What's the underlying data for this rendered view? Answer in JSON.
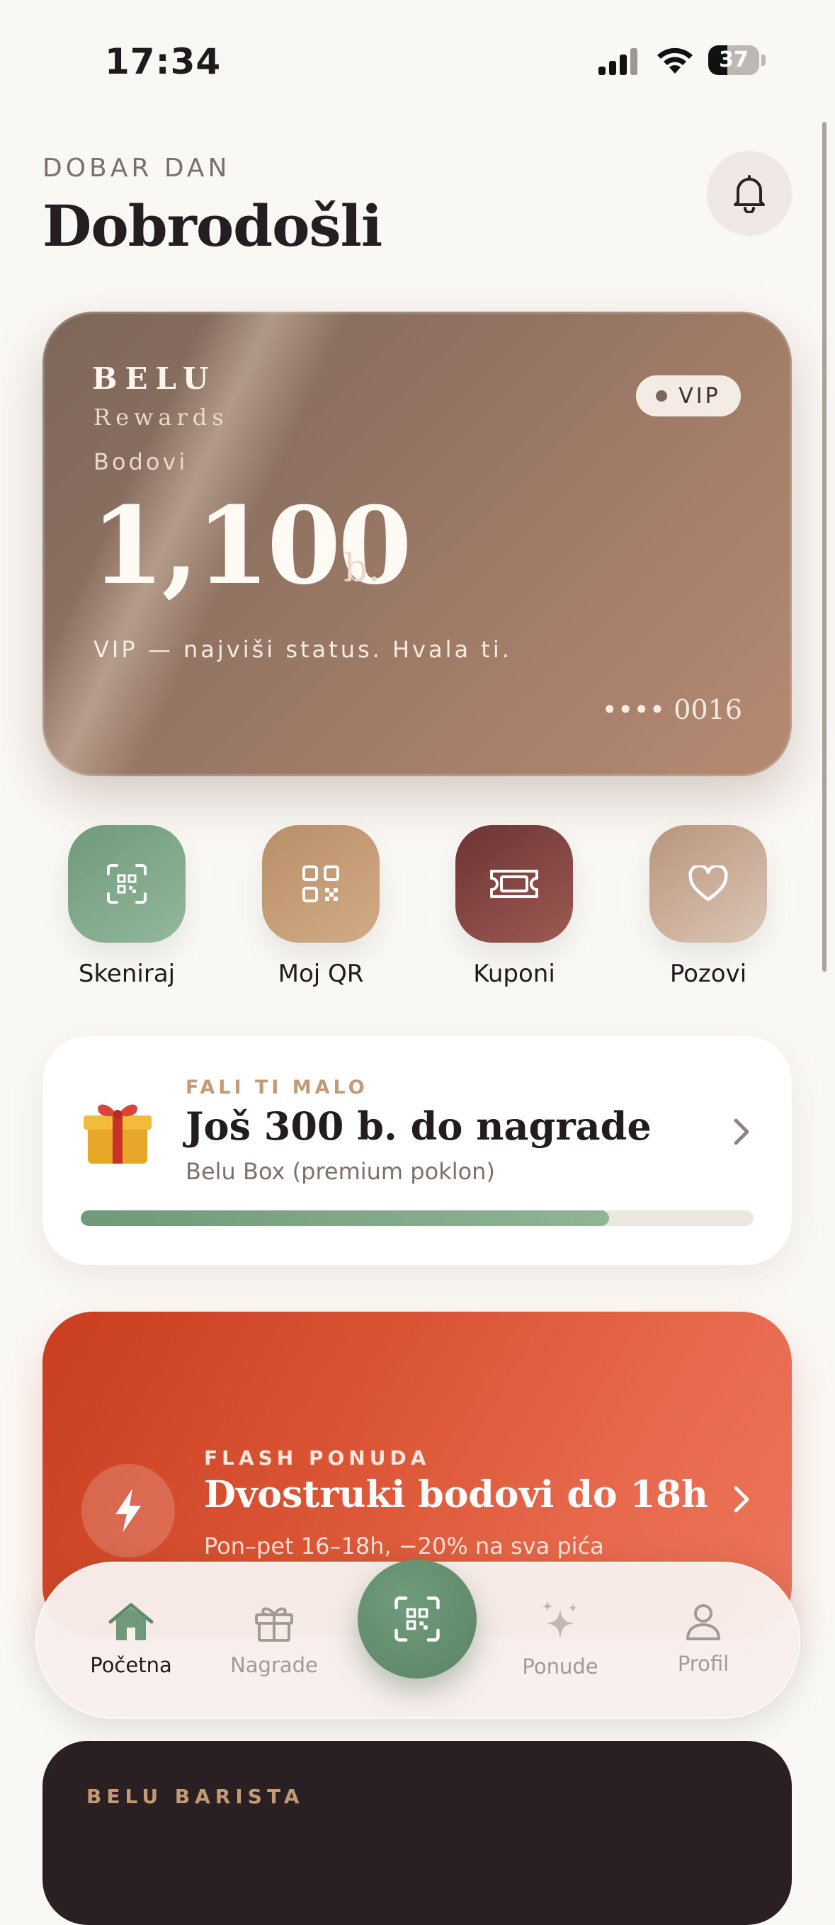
{
  "status_bar": {
    "time": "17:34",
    "battery": "37",
    "battery_level": 0.37
  },
  "header": {
    "greeting": "DOBAR DAN",
    "title": "Dobrodošli",
    "bell_icon": "bell-icon"
  },
  "loyalty_card": {
    "brand": "BELU",
    "subbrand": "Rewards",
    "points_label": "Bodovi",
    "points": "1,100",
    "points_unit": "b.",
    "tier_badge": "VIP",
    "status_text": "VIP — najviši status. Hvala ti.",
    "card_number": "•••• 0016"
  },
  "quick_actions": [
    {
      "label": "Skeniraj",
      "icon": "scan-qr-icon",
      "color": "#7ea487"
    },
    {
      "label": "Moj QR",
      "icon": "qr-code-icon",
      "color": "#c39a73"
    },
    {
      "label": "Kuponi",
      "icon": "ticket-icon",
      "color": "#7d3f3f"
    },
    {
      "label": "Pozovi",
      "icon": "heart-icon",
      "color": "#c8ab97"
    }
  ],
  "reward_progress": {
    "eyebrow": "FALI TI MALO",
    "title": "Još 300 b. do nagrade",
    "subtitle": "Belu Box (premium poklon)",
    "icon": "gift-icon",
    "progress": 0.785
  },
  "flash_offer": {
    "eyebrow": "FLASH PONUDA",
    "title": "Dvostruki bodovi do 18h",
    "subtitle": "Pon–pet 16–18h, −20% na sva pića",
    "icon": "lightning-icon"
  },
  "next_card": {
    "eyebrow": "BELU BARISTA"
  },
  "tab_bar": {
    "items": [
      {
        "label": "Početna",
        "icon": "home-icon",
        "active": true
      },
      {
        "label": "Nagrade",
        "icon": "gift-icon",
        "active": false
      },
      {
        "label": "Ponude",
        "icon": "sparkles-icon",
        "active": false
      },
      {
        "label": "Profil",
        "icon": "person-icon",
        "active": false
      }
    ],
    "center_icon": "scan-qr-icon"
  },
  "colors": {
    "accent_green": "#6f9979",
    "flash_red": "#d8512f",
    "card_bronze": "#9a7764",
    "background": "#faf8f5"
  }
}
